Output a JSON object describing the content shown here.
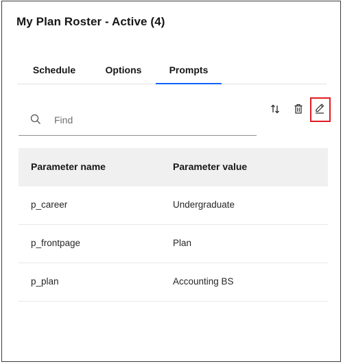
{
  "panel": {
    "title": "My Plan Roster - Active (4)"
  },
  "tabs": [
    {
      "label": "Schedule",
      "selected": false
    },
    {
      "label": "Options",
      "selected": false
    },
    {
      "label": "Prompts",
      "selected": true
    }
  ],
  "search": {
    "placeholder": "Find",
    "value": ""
  },
  "toolbar": {
    "sort_icon": "sort-icon",
    "delete_icon": "trash-icon",
    "edit_icon": "pencil-icon"
  },
  "colors": {
    "accent": "#0f62fe",
    "highlight": "#e11b22",
    "header_bg": "#f0f0f0"
  },
  "table": {
    "headers": [
      "Parameter name",
      "Parameter value"
    ],
    "rows": [
      [
        "p_career",
        "Undergraduate"
      ],
      [
        "p_frontpage",
        "Plan"
      ],
      [
        "p_plan",
        "Accounting BS"
      ]
    ]
  }
}
